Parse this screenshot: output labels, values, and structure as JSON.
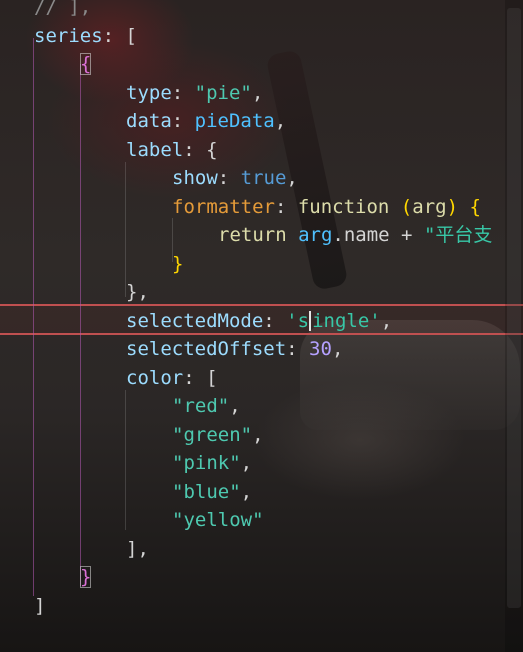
{
  "editor": {
    "lines": [
      {
        "indent": 1,
        "parts": [
          {
            "text": "// ],",
            "cls": "c-comment"
          }
        ]
      },
      {
        "indent": 1,
        "parts": [
          {
            "text": "series",
            "cls": "c-key"
          },
          {
            "text": ": [",
            "cls": "c-default"
          }
        ]
      },
      {
        "indent": 2,
        "parts": [
          {
            "text": "{",
            "cls": "c-magenta bracket-box"
          }
        ]
      },
      {
        "indent": 3,
        "parts": [
          {
            "text": "type",
            "cls": "c-key"
          },
          {
            "text": ": ",
            "cls": "c-default"
          },
          {
            "text": "\"pie\"",
            "cls": "c-string"
          },
          {
            "text": ",",
            "cls": "c-default"
          }
        ]
      },
      {
        "indent": 3,
        "parts": [
          {
            "text": "data",
            "cls": "c-key"
          },
          {
            "text": ": ",
            "cls": "c-default"
          },
          {
            "text": "pieData",
            "cls": "c-ident"
          },
          {
            "text": ",",
            "cls": "c-default"
          }
        ]
      },
      {
        "indent": 3,
        "parts": [
          {
            "text": "label",
            "cls": "c-key"
          },
          {
            "text": ": {",
            "cls": "c-default"
          }
        ]
      },
      {
        "indent": 4,
        "parts": [
          {
            "text": "show",
            "cls": "c-key"
          },
          {
            "text": ": ",
            "cls": "c-default"
          },
          {
            "text": "true",
            "cls": "c-bool"
          },
          {
            "text": ",",
            "cls": "c-default"
          }
        ]
      },
      {
        "indent": 4,
        "parts": [
          {
            "text": "formatter",
            "cls": "c-orange"
          },
          {
            "text": ": ",
            "cls": "c-default"
          },
          {
            "text": "function",
            "cls": "c-func-key"
          },
          {
            "text": " (",
            "cls": "c-yellow"
          },
          {
            "text": "arg",
            "cls": "c-func-key"
          },
          {
            "text": ") {",
            "cls": "c-yellow"
          }
        ]
      },
      {
        "indent": 5,
        "parts": [
          {
            "text": "return",
            "cls": "c-func-key"
          },
          {
            "text": " ",
            "cls": "c-default"
          },
          {
            "text": "arg",
            "cls": "c-ident"
          },
          {
            "text": ".name + ",
            "cls": "c-default"
          },
          {
            "text": "\"平台支",
            "cls": "c-string2"
          }
        ]
      },
      {
        "indent": 4,
        "parts": [
          {
            "text": "}",
            "cls": "c-yellow"
          }
        ]
      },
      {
        "indent": 3,
        "parts": [
          {
            "text": "},",
            "cls": "c-default"
          }
        ]
      },
      {
        "indent": 3,
        "current": true,
        "parts": [
          {
            "text": "selectedMode",
            "cls": "c-key"
          },
          {
            "text": ": ",
            "cls": "c-default"
          },
          {
            "text": "'s",
            "cls": "c-string2"
          },
          {
            "text": "|",
            "cls": "cursor"
          },
          {
            "text": "ingle'",
            "cls": "c-string2"
          },
          {
            "text": ",",
            "cls": "c-default"
          }
        ]
      },
      {
        "indent": 3,
        "parts": [
          {
            "text": "selectedOffset",
            "cls": "c-key"
          },
          {
            "text": ": ",
            "cls": "c-default"
          },
          {
            "text": "30",
            "cls": "c-num"
          },
          {
            "text": ",",
            "cls": "c-default"
          }
        ]
      },
      {
        "indent": 3,
        "parts": [
          {
            "text": "color",
            "cls": "c-key"
          },
          {
            "text": ": [",
            "cls": "c-default"
          }
        ]
      },
      {
        "indent": 4,
        "parts": [
          {
            "text": "\"red\"",
            "cls": "c-string"
          },
          {
            "text": ",",
            "cls": "c-default"
          }
        ]
      },
      {
        "indent": 4,
        "parts": [
          {
            "text": "\"green\"",
            "cls": "c-string"
          },
          {
            "text": ",",
            "cls": "c-default"
          }
        ]
      },
      {
        "indent": 4,
        "parts": [
          {
            "text": "\"pink\"",
            "cls": "c-string"
          },
          {
            "text": ",",
            "cls": "c-default"
          }
        ]
      },
      {
        "indent": 4,
        "parts": [
          {
            "text": "\"blue\"",
            "cls": "c-string"
          },
          {
            "text": ",",
            "cls": "c-default"
          }
        ]
      },
      {
        "indent": 4,
        "parts": [
          {
            "text": "\"yellow\"",
            "cls": "c-string"
          }
        ]
      },
      {
        "indent": 3,
        "parts": [
          {
            "text": "],",
            "cls": "c-default"
          }
        ]
      },
      {
        "indent": 2,
        "parts": [
          {
            "text": "}",
            "cls": "c-magenta bracket-box"
          }
        ]
      },
      {
        "indent": 1,
        "parts": [
          {
            "text": "]",
            "cls": "c-default"
          }
        ]
      }
    ]
  },
  "theme": {
    "accent_current_line": "#c05050",
    "key_color": "#9cdcfe",
    "string_color": "#4ec9b0",
    "number_color": "#b5a1ff",
    "bool_color": "#569cd6",
    "bracket_color": "#da70d6",
    "function_color": "#dcdcaa"
  }
}
